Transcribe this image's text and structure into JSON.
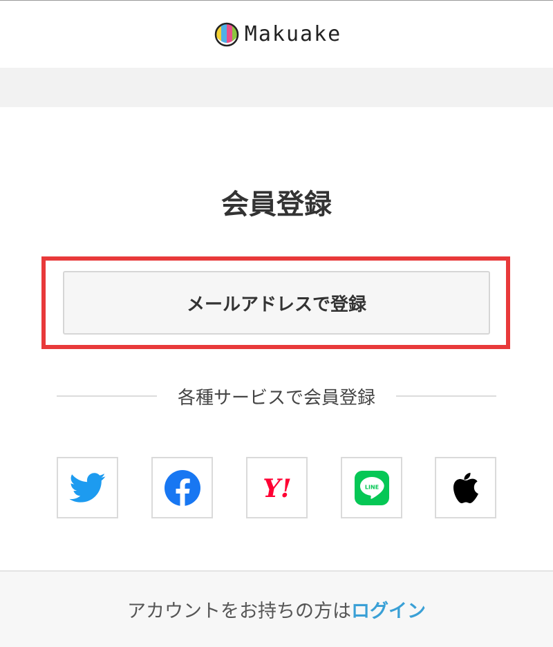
{
  "header": {
    "brand": "Makuake"
  },
  "main": {
    "title": "会員登録",
    "email_button_label": "メールアドレスで登録",
    "divider_text": "各種サービスで会員登録"
  },
  "social_buttons": [
    {
      "service": "Twitter",
      "icon": "twitter-icon",
      "color": "#1d9bf0"
    },
    {
      "service": "Facebook",
      "icon": "facebook-icon",
      "color": "#1877f2"
    },
    {
      "service": "Yahoo! JAPAN",
      "icon": "yahoo-icon",
      "color": "#ff0033",
      "logo_text": "Y!"
    },
    {
      "service": "LINE",
      "icon": "line-icon",
      "color": "#06c755",
      "logo_text": "LINE"
    },
    {
      "service": "Apple",
      "icon": "apple-icon",
      "color": "#000000"
    }
  ],
  "footer": {
    "prompt_text": "アカウントをお持ちの方は",
    "login_link": "ログイン"
  },
  "colors": {
    "highlight": "#e8393a",
    "link": "#3aa0d6",
    "page_bg": "#f2f2f2"
  }
}
